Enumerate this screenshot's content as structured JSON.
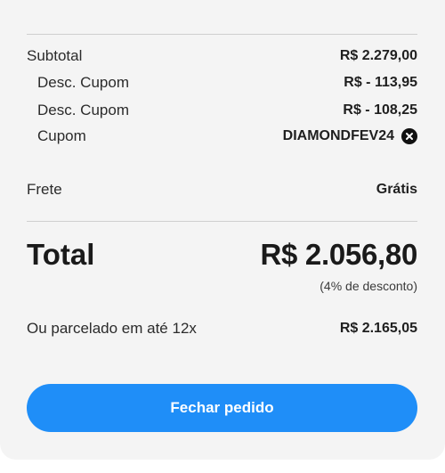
{
  "summary": {
    "subtotal": {
      "label": "Subtotal",
      "value": "R$ 2.279,00"
    },
    "discounts": [
      {
        "label": "Desc. Cupom",
        "value": "R$ - 113,95"
      },
      {
        "label": "Desc. Cupom",
        "value": "R$ - 108,25"
      }
    ],
    "coupon": {
      "label": "Cupom",
      "code": "DIAMONDFEV24",
      "remove_icon": "close-circle-icon"
    },
    "shipping": {
      "label": "Frete",
      "value": "Grátis"
    },
    "total": {
      "label": "Total",
      "value": "R$ 2.056,80",
      "discount_note": "(4% de desconto)"
    },
    "installments": {
      "label": "Ou parcelado em até 12x",
      "value": "R$ 2.165,05"
    }
  },
  "actions": {
    "checkout_label": "Fechar pedido"
  },
  "colors": {
    "accent": "#1f8ef8",
    "card_background": "#f4f4f4",
    "divider": "#cfcfcf"
  }
}
